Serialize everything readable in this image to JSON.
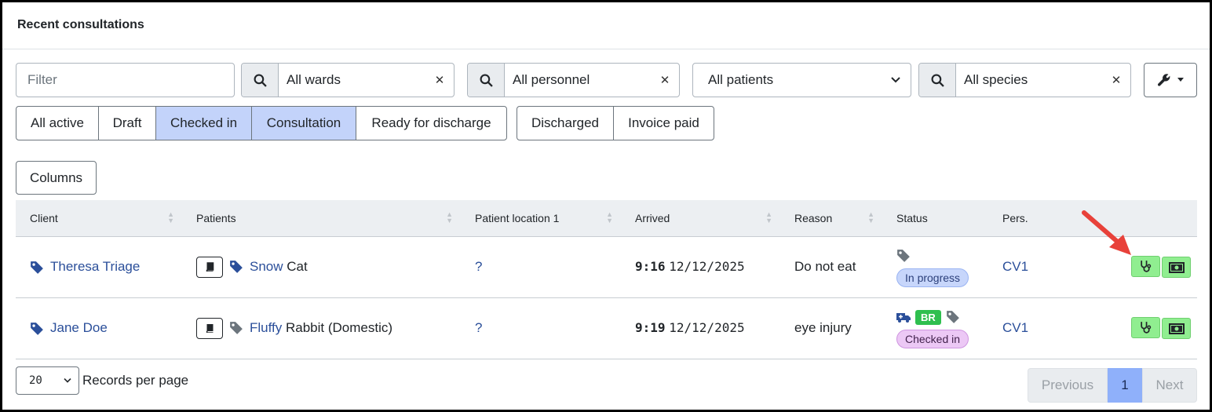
{
  "header": {
    "title": "Recent consultations"
  },
  "filters": {
    "filter_placeholder": "Filter",
    "wards": "All wards",
    "personnel": "All personnel",
    "patients": "All patients",
    "species": "All species"
  },
  "status_tabs": {
    "group1": [
      "All active",
      "Draft",
      "Checked in",
      "Consultation",
      "Ready for discharge"
    ],
    "group2": [
      "Discharged",
      "Invoice paid"
    ]
  },
  "columns_button": "Columns",
  "table": {
    "headers": {
      "client": "Client",
      "patients": "Patients",
      "location": "Patient location 1",
      "arrived": "Arrived",
      "reason": "Reason",
      "status": "Status",
      "pers": "Pers."
    },
    "rows": [
      {
        "client": "Theresa Triage",
        "patient_name": "Snow",
        "patient_species": "Cat",
        "location": "?",
        "time": "9:16",
        "date": "12/12/2025",
        "reason": "Do not eat",
        "status": "In progress",
        "pers": "CV1"
      },
      {
        "client": "Jane Doe",
        "patient_name": "Fluffy",
        "patient_species": "Rabbit (Domestic)",
        "location": "?",
        "time": "9:19",
        "date": "12/12/2025",
        "reason": "eye injury",
        "status": "Checked in",
        "status_badge": "BR",
        "pers": "CV1"
      }
    ]
  },
  "footer": {
    "per_page": "20",
    "per_page_label": "Records per page",
    "pager": {
      "prev": "Previous",
      "current": "1",
      "next": "Next"
    }
  },
  "colors": {
    "accent_link": "#2b4f9a",
    "active_tab": "#c3d3fa",
    "action_green": "#90ee90",
    "pager_current": "#8fb0fa",
    "annotation_arrow": "#e8413a"
  },
  "icons": [
    "tag-icon",
    "search-icon",
    "wrench-icon",
    "book-icon",
    "stethoscope-icon",
    "money-icon",
    "ambulance-icon",
    "chevron-down-icon",
    "close-icon"
  ]
}
